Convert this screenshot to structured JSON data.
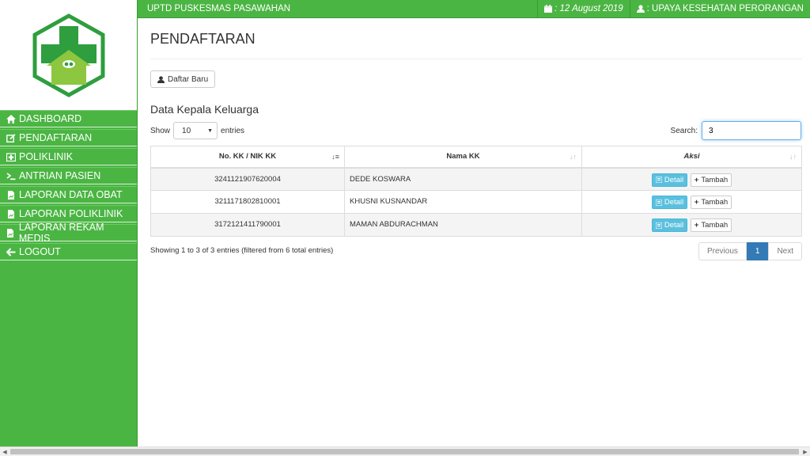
{
  "topbar": {
    "brand": "UPTD PUSKESMAS PASAWAHAN",
    "date": ": 12 August 2019",
    "user": ": UPAYA KESEHATAN PERORANGAN"
  },
  "sidebar": {
    "items": [
      {
        "label": "DASHBOARD",
        "icon": "home-icon"
      },
      {
        "label": "PENDAFTARAN",
        "icon": "edit-icon"
      },
      {
        "label": "POLIKLINIK",
        "icon": "hospital-icon"
      },
      {
        "label": "ANTRIAN PASIEN",
        "icon": "terminal-icon"
      },
      {
        "label": "LAPORAN DATA OBAT",
        "icon": "report-icon"
      },
      {
        "label": "LAPORAN POLIKLINIK",
        "icon": "report-icon"
      },
      {
        "label": "LAPORAN REKAM MEDIS",
        "icon": "report-icon"
      },
      {
        "label": "LOGOUT",
        "icon": "arrow-left-icon"
      }
    ]
  },
  "main": {
    "title": "PENDAFTARAN",
    "new_button": "Daftar Baru",
    "section_title": "Data Kepala Keluarga",
    "show_label": "Show",
    "entries_label": "entries",
    "page_length": "10",
    "search_label": "Search:",
    "search_value": "3",
    "columns": [
      "No. KK / NIK KK",
      "Nama KK",
      "Aksi"
    ],
    "rows": [
      {
        "kk": "3241121907620004",
        "nama": "DEDE KOSWARA"
      },
      {
        "kk": "3211171802810001",
        "nama": "KHUSNI KUSNANDAR"
      },
      {
        "kk": "3172121411790001",
        "nama": "MAMAN ABDURACHMAN"
      }
    ],
    "detail_label": "Detail",
    "tambah_label": "Tambah",
    "info": "Showing 1 to 3 of 3 entries (filtered from 6 total entries)",
    "pager": {
      "prev": "Previous",
      "current": "1",
      "next": "Next"
    }
  },
  "colors": {
    "brand_green": "#4bb543",
    "accent_blue": "#337ab7",
    "info_blue": "#5bc0de"
  }
}
